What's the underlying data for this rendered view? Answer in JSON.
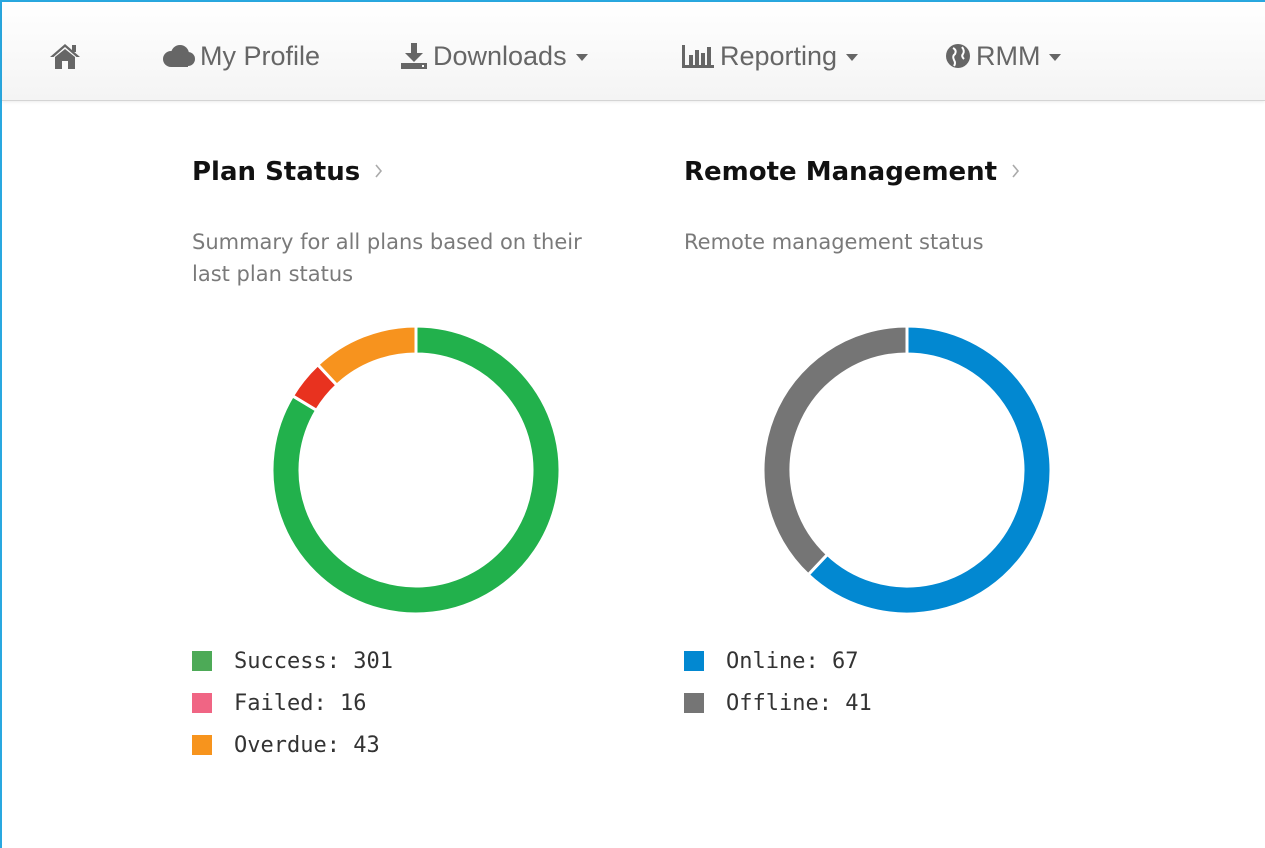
{
  "navbar": {
    "home": {
      "icon": "home-icon"
    },
    "items": [
      {
        "label": "My Profile",
        "icon": "cloud-icon",
        "has_dropdown": false
      },
      {
        "label": "Downloads",
        "icon": "download-icon",
        "has_dropdown": true
      },
      {
        "label": "Reporting",
        "icon": "bar-chart-icon",
        "has_dropdown": true
      },
      {
        "label": "RMM",
        "icon": "globe-icon",
        "has_dropdown": true
      }
    ]
  },
  "cards": [
    {
      "title": "Plan Status",
      "subtitle": "Summary for all plans based on their last plan status",
      "legend": [
        {
          "text": "Success: 301",
          "color": "#4daa57"
        },
        {
          "text": "Failed: 16",
          "color": "#f06584"
        },
        {
          "text": "Overdue: 43",
          "color": "#f7941d"
        }
      ]
    },
    {
      "title": "Remote Management",
      "subtitle": "Remote management status",
      "legend": [
        {
          "text": "Online: 67",
          "color": "#0288d1"
        },
        {
          "text": "Offline: 41",
          "color": "#757575"
        }
      ]
    }
  ],
  "chart_data": [
    {
      "type": "pie",
      "subtype": "donut",
      "categories": [
        "Success",
        "Failed",
        "Overdue"
      ],
      "values": [
        301,
        16,
        43
      ],
      "colors": [
        "#22b14c",
        "#e8321f",
        "#f7931e"
      ]
    },
    {
      "type": "pie",
      "subtype": "donut",
      "categories": [
        "Online",
        "Offline"
      ],
      "values": [
        67,
        41
      ],
      "colors": [
        "#0288d1",
        "#757575"
      ]
    }
  ]
}
